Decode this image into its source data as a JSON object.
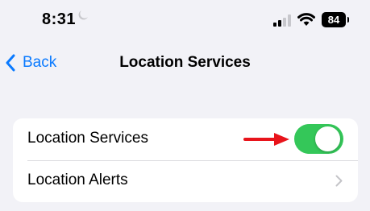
{
  "status_bar": {
    "time": "8:31",
    "battery": "84",
    "icons": [
      "moon-icon",
      "cellular-signal-icon",
      "wifi-icon",
      "battery-icon"
    ]
  },
  "nav": {
    "back_label": "Back",
    "title": "Location Services"
  },
  "settings": {
    "rows": [
      {
        "label": "Location Services",
        "control": "toggle",
        "on": true
      },
      {
        "label": "Location Alerts",
        "control": "chevron-right-icon"
      }
    ]
  },
  "annotation": {
    "icon": "red-arrow-icon",
    "color": "#e8141b"
  },
  "colors": {
    "accent": "#0a7aff",
    "toggle_on": "#34c759",
    "background": "#f2f2f7"
  }
}
